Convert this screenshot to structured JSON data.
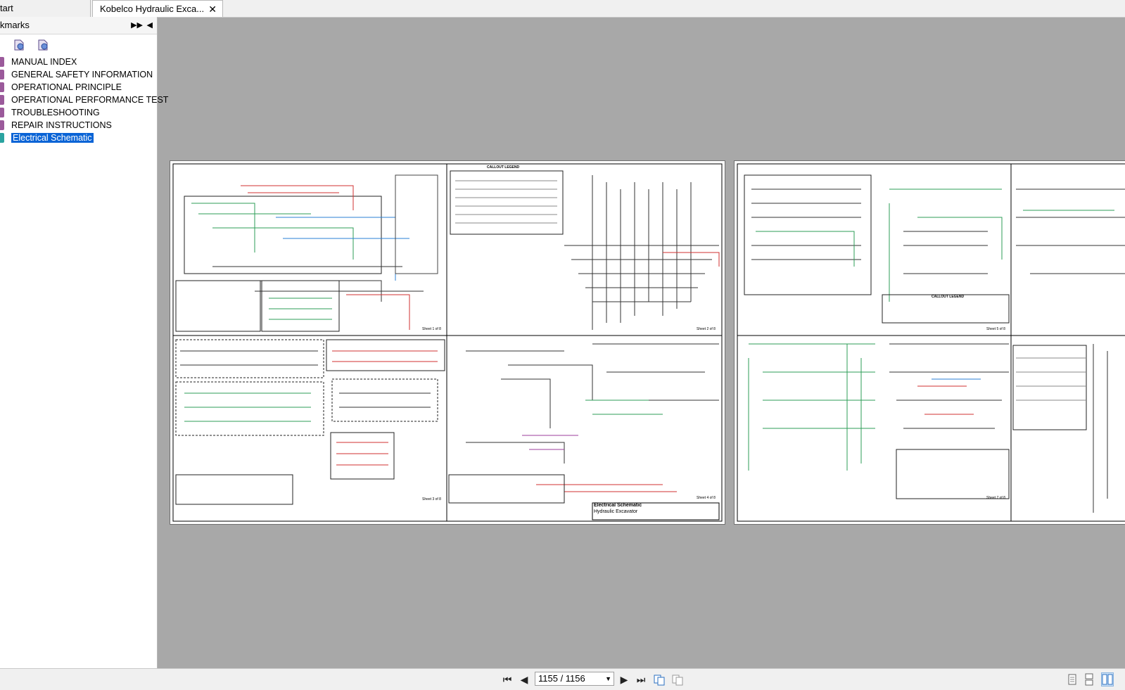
{
  "tabs": [
    {
      "label": "tart"
    },
    {
      "label": "Kobelco Hydraulic Exca...",
      "close": "✕"
    }
  ],
  "sidebar": {
    "title": "kmarks",
    "expand_icon": "double-chevron-right-icon",
    "collapse_icon": "triangle-left-icon",
    "tool_icons": [
      "bookmark-expand-icon",
      "bookmark-collapse-icon"
    ],
    "items": [
      {
        "label": "MANUAL INDEX"
      },
      {
        "label": "GENERAL SAFETY INFORMATION"
      },
      {
        "label": "OPERATIONAL PRINCIPLE"
      },
      {
        "label": "OPERATIONAL PERFORMANCE TEST"
      },
      {
        "label": "TROUBLESHOOTING"
      },
      {
        "label": "REPAIR INSTRUCTIONS"
      },
      {
        "label": "Electrical Schematic",
        "selected": true
      }
    ]
  },
  "document": {
    "pages": [
      {
        "sheet_labels": [
          "Sheet 1 of 8",
          "Sheet 2 of 8",
          "Sheet 3 of 8",
          "Sheet 4 of 8"
        ],
        "legend_title": "CALLOUT LEGEND"
      },
      {
        "sheet_labels": [
          "Sheet 5 of 8",
          "Sheet 7 of 8"
        ],
        "legend_title": "CALLOUT LEGEND"
      }
    ],
    "title_block": {
      "title": "Electrical Schematic",
      "subtitle": "Hydraulic Excavator"
    }
  },
  "toolbar": {
    "page_value": "1155 / 1156",
    "icons": [
      "first-page-icon",
      "previous-page-icon",
      "next-page-icon",
      "last-page-icon",
      "previous-view-icon",
      "next-view-icon",
      "single-page-view-icon",
      "continuous-view-icon",
      "two-page-view-icon"
    ]
  },
  "colors": {
    "selection": "#0a64d6",
    "bookmark_marker": "#9b5a9b",
    "bookmark_marker_selected": "#2aa3a0",
    "wire_green": "#2e9d57",
    "wire_red": "#d23030",
    "wire_blue": "#2a7fd4"
  }
}
